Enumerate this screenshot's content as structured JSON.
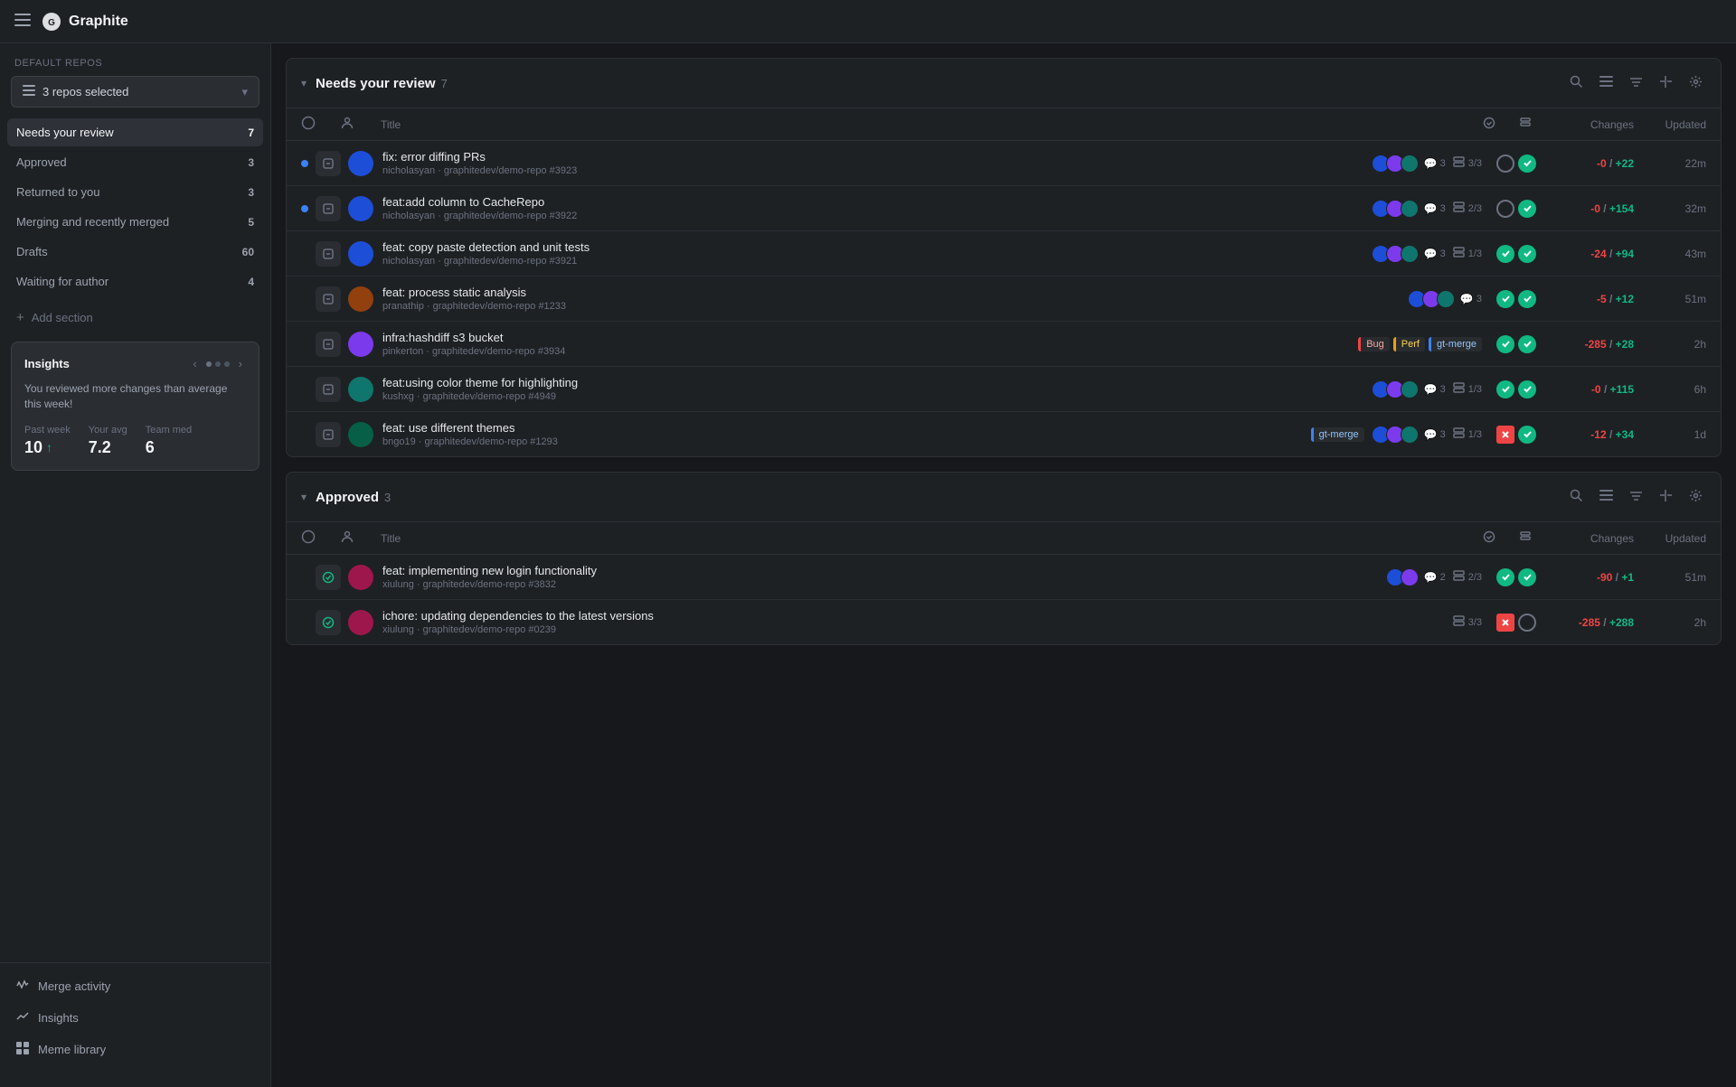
{
  "app": {
    "title": "Graphite",
    "logo_alt": "graphite-logo"
  },
  "sidebar": {
    "default_repos_label": "Default repos",
    "repo_selector_value": "3 repos selected",
    "nav_items": [
      {
        "id": "needs-review",
        "label": "Needs your review",
        "count": "7",
        "active": true
      },
      {
        "id": "approved",
        "label": "Approved",
        "count": "3",
        "active": false
      },
      {
        "id": "returned",
        "label": "Returned to you",
        "count": "3",
        "active": false
      },
      {
        "id": "merging",
        "label": "Merging and recently merged",
        "count": "5",
        "active": false
      },
      {
        "id": "drafts",
        "label": "Drafts",
        "count": "60",
        "active": false
      },
      {
        "id": "waiting",
        "label": "Waiting for author",
        "count": "4",
        "active": false
      }
    ],
    "add_section_label": "+ Add section",
    "insights_card": {
      "title": "Insights",
      "text": "You reviewed more changes than average this week!",
      "stats": [
        {
          "label": "Past week",
          "value": "10",
          "up": true
        },
        {
          "label": "Your avg",
          "value": "7.2",
          "up": false
        },
        {
          "label": "Team med",
          "value": "6",
          "up": false
        }
      ]
    },
    "bottom_nav": [
      {
        "id": "merge-activity",
        "label": "Merge activity",
        "icon": "activity"
      },
      {
        "id": "insights",
        "label": "Insights",
        "icon": "chart"
      },
      {
        "id": "meme-library",
        "label": "Meme library",
        "icon": "grid"
      }
    ]
  },
  "sections": [
    {
      "id": "needs-review",
      "title": "Needs your review",
      "count": "7",
      "columns": [
        "Title",
        "Changes",
        "Updated"
      ],
      "rows": [
        {
          "has_dot": true,
          "title": "fix: error diffing PRs",
          "meta": "nicholasyan · graphitedev/demo-repo #3923",
          "labels": [],
          "reviewer_count": "3",
          "stack": "3/3",
          "ci1": "pending",
          "ci2": "success",
          "changes_neg": "-0",
          "changes_pos": "+22",
          "updated": "22m",
          "avatar_color": "av-blue"
        },
        {
          "has_dot": true,
          "title": "feat:add column to CacheRepo",
          "meta": "nicholasyan · graphitedev/demo-repo #3922",
          "labels": [],
          "reviewer_count": "3",
          "stack": "2/3",
          "ci1": "pending",
          "ci2": "success",
          "changes_neg": "-0",
          "changes_pos": "+154",
          "updated": "32m",
          "avatar_color": "av-blue"
        },
        {
          "has_dot": false,
          "title": "feat: copy paste detection and unit tests",
          "meta": "nicholasyan · graphitedev/demo-repo #3921",
          "labels": [],
          "reviewer_count": "3",
          "stack": "1/3",
          "ci1": "success",
          "ci2": "success",
          "changes_neg": "-24",
          "changes_pos": "+94",
          "updated": "43m",
          "avatar_color": "av-blue"
        },
        {
          "has_dot": false,
          "title": "feat: process static analysis",
          "meta": "pranathip · graphitedev/demo-repo #1233",
          "labels": [],
          "reviewer_count": "3",
          "stack": "",
          "ci1": "success",
          "ci2": "success",
          "changes_neg": "-5",
          "changes_pos": "+12",
          "updated": "51m",
          "avatar_color": "av-orange"
        },
        {
          "has_dot": false,
          "title": "infra:hashdiff s3 bucket",
          "meta": "pinkerton · graphitedev/demo-repo #3934",
          "labels": [
            "Bug",
            "Perf",
            "gt-merge"
          ],
          "reviewer_count": "",
          "stack": "",
          "ci1": "success",
          "ci2": "success",
          "changes_neg": "-285",
          "changes_pos": "+28",
          "updated": "2h",
          "avatar_color": "av-purple"
        },
        {
          "has_dot": false,
          "title": "feat:using color theme for highlighting",
          "meta": "kushxg · graphitedev/demo-repo #4949",
          "labels": [],
          "reviewer_count": "3",
          "stack": "1/3",
          "ci1": "success",
          "ci2": "success",
          "changes_neg": "-0",
          "changes_pos": "+115",
          "updated": "6h",
          "avatar_color": "av-teal"
        },
        {
          "has_dot": false,
          "title": "feat: use different themes",
          "meta": "bngo19 · graphitedev/demo-repo #1293",
          "labels": [
            "gt-merge"
          ],
          "reviewer_count": "3",
          "stack": "1/3",
          "ci1": "fail",
          "ci2": "success",
          "changes_neg": "-12",
          "changes_pos": "+34",
          "updated": "1d",
          "avatar_color": "av-green"
        }
      ]
    },
    {
      "id": "approved",
      "title": "Approved",
      "count": "3",
      "columns": [
        "Title",
        "Changes",
        "Updated"
      ],
      "rows": [
        {
          "has_dot": false,
          "title": "feat: implementing new login functionality",
          "meta": "xiulung · graphitedev/demo-repo #3832",
          "labels": [],
          "reviewer_count": "2",
          "stack": "2/3",
          "ci1": "success",
          "ci2": "success",
          "changes_neg": "-90",
          "changes_pos": "+1",
          "updated": "51m",
          "avatar_color": "av-pink",
          "row_icon": "approved"
        },
        {
          "has_dot": false,
          "title": "ichore: updating dependencies to the latest versions",
          "meta": "xiulung · graphitedev/demo-repo #0239",
          "labels": [],
          "reviewer_count": "",
          "stack": "3/3",
          "ci1": "fail",
          "ci2": "pending-circle",
          "changes_neg": "-285",
          "changes_pos": "+288",
          "updated": "2h",
          "avatar_color": "av-pink",
          "row_icon": "approved"
        }
      ]
    }
  ]
}
